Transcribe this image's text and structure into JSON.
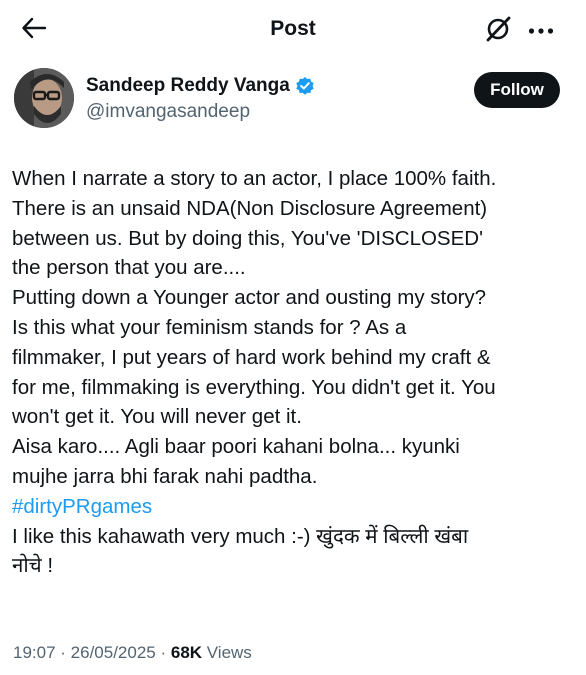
{
  "header": {
    "title": "Post",
    "back_icon": "arrow-left-icon",
    "grok_icon": "grok-icon",
    "more_icon": "more-horizontal-icon"
  },
  "author": {
    "display_name": "Sandeep Reddy Vanga",
    "handle": "@imvangasandeep",
    "verified": true,
    "verified_color": "#1d9bf0",
    "follow_label": "Follow"
  },
  "post": {
    "lines": [
      "When I narrate a story to an actor, I place 100% faith.",
      "There is an unsaid NDA(Non Disclosure Agreement)",
      "between us. But by doing this, You've 'DISCLOSED'",
      "the person that you are....",
      "Putting down a Younger actor and ousting my story?",
      "Is this what your feminism stands for ? As a",
      "filmmaker, I put years of hard work behind my craft &",
      "for me, filmmaking is everything. You didn't get it. You",
      "won't get it. You will never get it.",
      "Aisa karo.... Agli baar poori kahani bolna... kyunki",
      "mujhe jarra bhi farak nahi padtha."
    ],
    "hashtag": " #dirtyPRgames",
    "closing_lines": [
      "I like this kahawath very much :-) खुंदक में बिल्ली खंबा",
      "नोचे !"
    ]
  },
  "meta": {
    "time": "19:07",
    "sep1": " · ",
    "date": "26/05/2025",
    "sep2": " · ",
    "views_count": "68K",
    "views_label": " Views"
  },
  "colors": {
    "text": "#0f1419",
    "secondary": "#536471",
    "link": "#1d9bf0",
    "follow_bg": "#0f1419"
  }
}
